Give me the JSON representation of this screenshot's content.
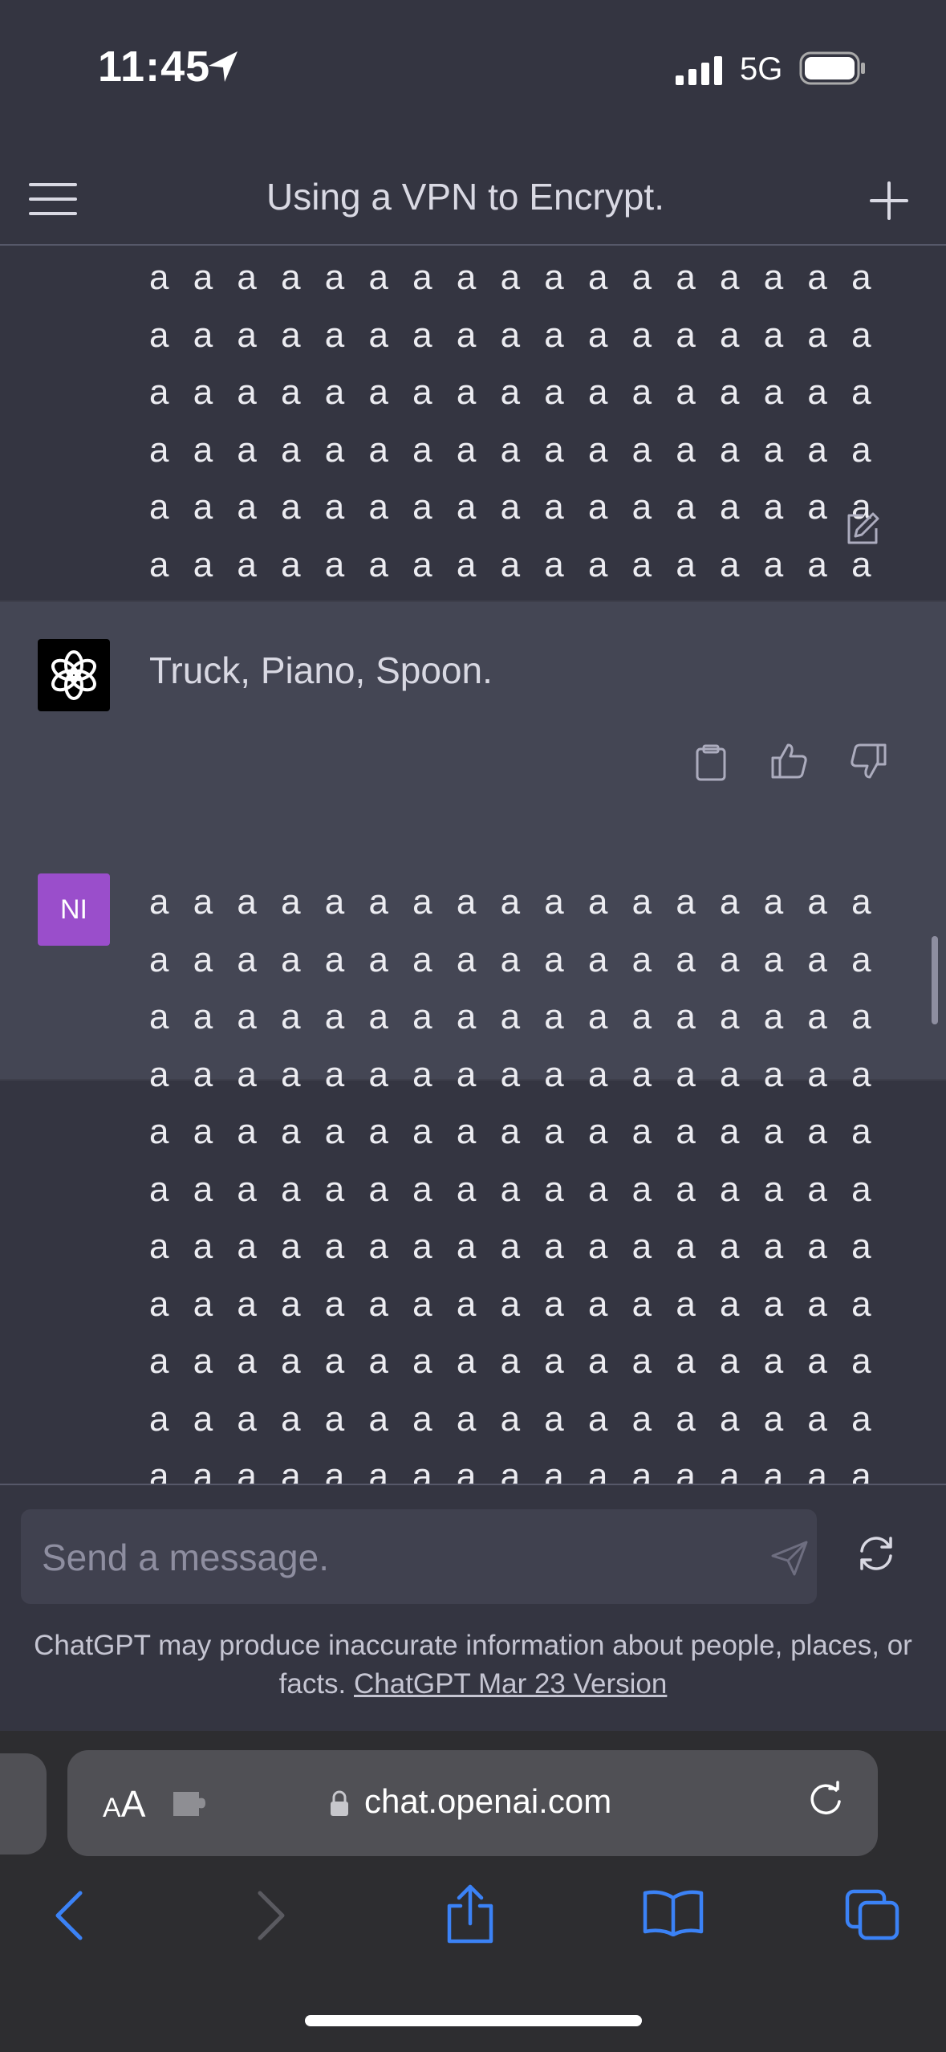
{
  "status_bar": {
    "time": "11:45",
    "network": "5G",
    "icons": [
      "location-arrow-icon",
      "signal-bars-icon",
      "battery-icon"
    ]
  },
  "header": {
    "title": "Using a VPN to Encrypt.",
    "menu_icon": "hamburger-menu-icon",
    "new_chat_icon": "plus-icon"
  },
  "conversation": {
    "user_message_1": "a a a a a a a a a a a a a a a a a a a a a a a a a a a a a a a a a a a a a a a a a a a a a a a a a a a a a a a a a a a a a a a a a a a a a a a a a a a a a a a a a a a a a a a a a a a a a a a a a a a a a a a a a a a a a a a a a a a a a a a",
    "assistant_message": "Truck, Piano, Spoon.",
    "user_avatar_initials": "NI",
    "user_message_2": "a a a a a a a a a a a a a a a a a a a a a a a a a a a a a a a a a a a a a a a a a a a a a a a a a a a a a a a a a a a a a a a a a a a a a a a a a a a a a a a a a a a a a a a a a a a a a a a a a a a a a a a a a a a a a a a a a a a a a a a a a a a a a a a a a a a a a a a a a a a a a a a a a a a a a a a a a a a a a a a a a a a a a a a a a a a a a a a a a a a a a a a a a a a a a a a a a a a a a a a a a a a a a a a a a a a a a a a a a a a a a a a a a a a a a a a a a a a a a a a a a a a a a a a a a a a a a a a a a a a a a a a a a a a a a a a a a a a a a a a a a a a a a a a a a a a a a a a a a a a a a a a a a a a a a a a a a a a a a a a a a a a a a a a a a a a a a a a a a a a a a a"
  },
  "composer": {
    "placeholder": "Send a message.",
    "disclaimer": "ChatGPT may produce inaccurate information about people, places, or facts. ",
    "version_link": "ChatGPT Mar 23 Version"
  },
  "browser": {
    "aa_label_small": "A",
    "aa_label_large": "A",
    "url": "chat.openai.com"
  },
  "colors": {
    "background": "#343541",
    "assistant_row": "#444654",
    "user_avatar": "#9a4ecb",
    "safari_accent": "#3b82f6"
  }
}
